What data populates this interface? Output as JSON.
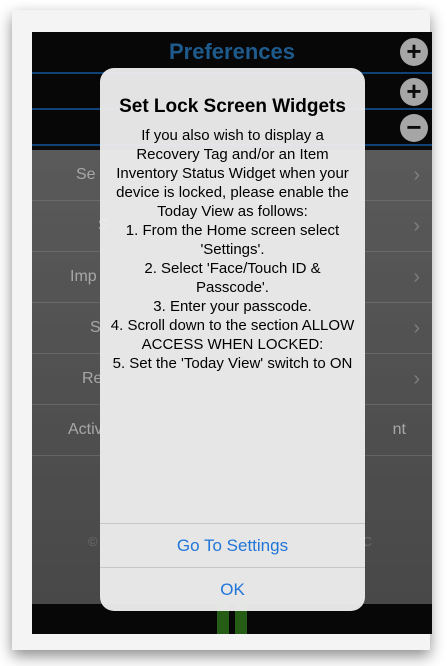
{
  "header": {
    "title": "Preferences"
  },
  "icons": {
    "add": "plus-circle-icon",
    "remove": "minus-circle-icon",
    "glyph_plus": "+",
    "glyph_minus": "−"
  },
  "menu": {
    "rows": [
      {
        "label": "Se",
        "fragment": true
      },
      {
        "label": "S",
        "fragment": true
      },
      {
        "label": "Imp",
        "fragment": true
      },
      {
        "label": "S",
        "fragment": true
      },
      {
        "label": "Re",
        "fragment": true
      },
      {
        "label": "Activ",
        "suffix": "nt",
        "fragment": true
      }
    ],
    "footer_left": "©",
    "footer_right": "LC"
  },
  "alert": {
    "title": "Set Lock Screen Widgets",
    "message": "If you also wish to display a Recovery Tag and/or an Item Inventory Status Widget when your device is locked, please enable the Today View as follows:\n1. From the Home screen select 'Settings'.\n2. Select 'Face/Touch ID & Passcode'.\n3. Enter your passcode.\n4. Scroll down to the section ALLOW ACCESS WHEN LOCKED:\n5. Set the 'Today View' switch to ON",
    "primary_button": "Go To Settings",
    "secondary_button": "OK"
  },
  "colors": {
    "accent": "#2e8ad8",
    "link": "#1f75d8",
    "tab_green": "#3b8f22"
  }
}
